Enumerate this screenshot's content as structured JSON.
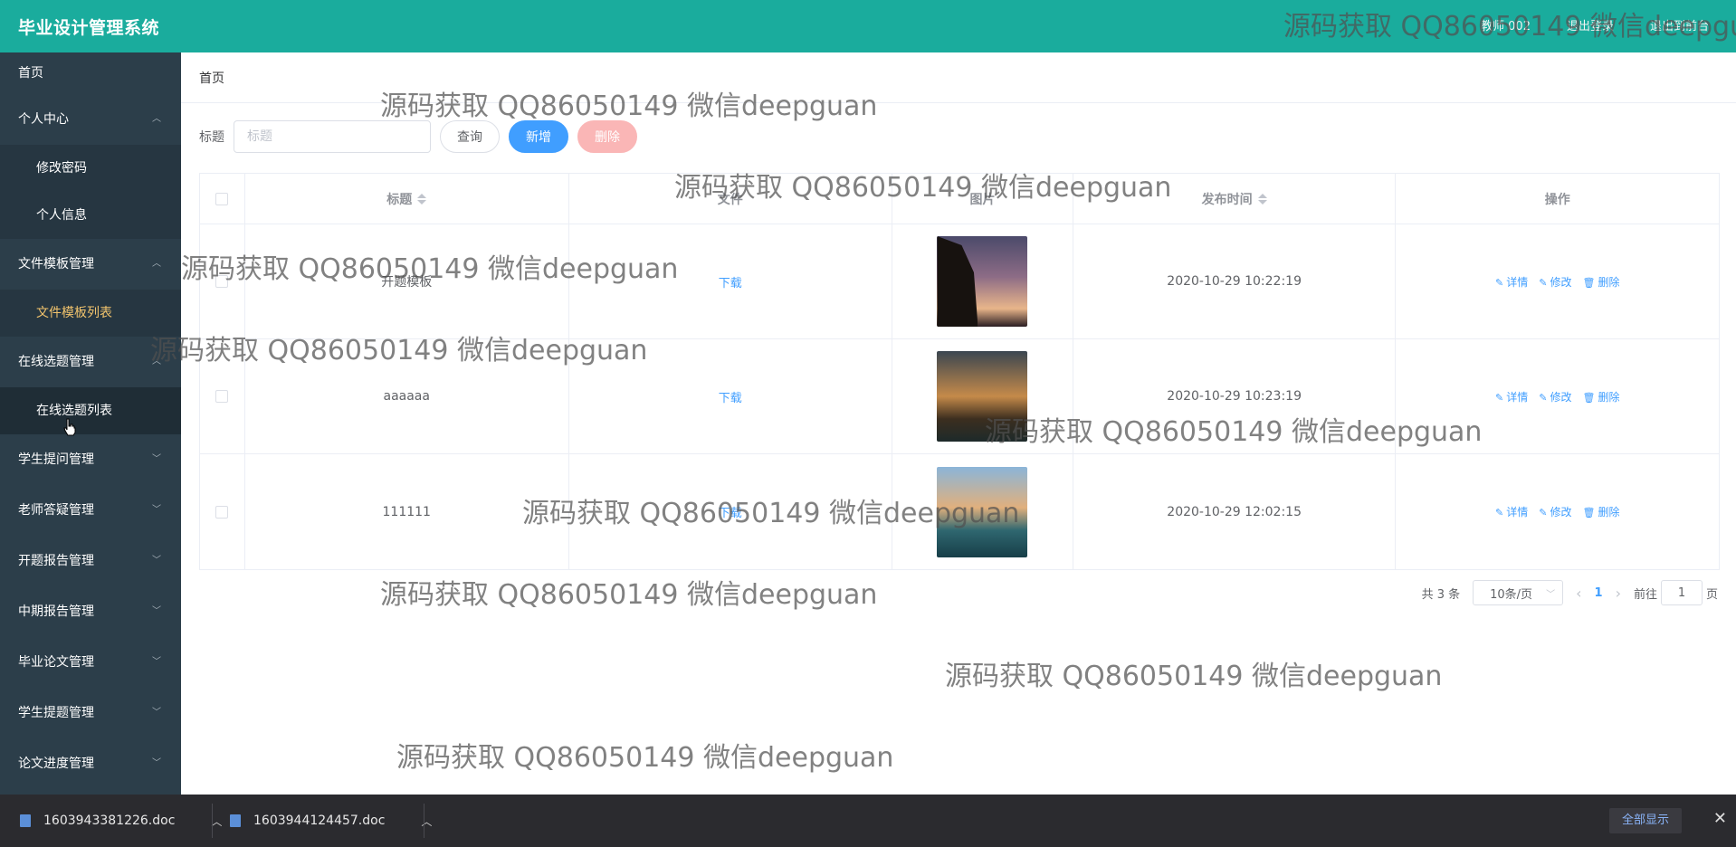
{
  "header": {
    "title": "毕业设计管理系统",
    "right_items": [
      "教师 002",
      "退出登录",
      "退出到前台"
    ]
  },
  "sidebar": {
    "items": [
      {
        "label": "首页"
      },
      {
        "label": "个人中心",
        "children": [
          "修改密码",
          "个人信息"
        ]
      },
      {
        "label": "文件模板管理",
        "children": [
          "文件模板列表"
        ]
      },
      {
        "label": "在线选题管理",
        "children": [
          "在线选题列表"
        ]
      },
      {
        "label": "学生提问管理"
      },
      {
        "label": "老师答疑管理"
      },
      {
        "label": "开题报告管理"
      },
      {
        "label": "中期报告管理"
      },
      {
        "label": "毕业论文管理"
      },
      {
        "label": "学生提题管理"
      },
      {
        "label": "论文进度管理"
      }
    ],
    "active_child": "文件模板列表"
  },
  "breadcrumb": "首页",
  "search": {
    "label": "标题",
    "placeholder": "标题",
    "query_btn": "查询",
    "add_btn": "新增",
    "delete_btn": "删除"
  },
  "table": {
    "headers": [
      "标题",
      "文件",
      "图片",
      "发布时间",
      "操作"
    ],
    "rows": [
      {
        "title": "开题模板",
        "file": "下载",
        "time": "2020-10-29 10:22:19"
      },
      {
        "title": "aaaaaa",
        "file": "下载",
        "time": "2020-10-29 10:23:19"
      },
      {
        "title": "111111",
        "file": "下载",
        "time": "2020-10-29 12:02:15"
      }
    ],
    "ops": [
      "详情",
      "修改",
      "删除"
    ]
  },
  "pagination": {
    "total": "共 3 条",
    "page_size": "10条/页",
    "current_page": "1",
    "jump_prefix": "前往",
    "jump_value": "1",
    "jump_suffix": "页"
  },
  "watermark_text": "源码获取 QQ86050149 微信deepguan",
  "downloads": {
    "files": [
      "1603943381226.doc",
      "1603944124457.doc"
    ],
    "show_all": "全部显示"
  }
}
